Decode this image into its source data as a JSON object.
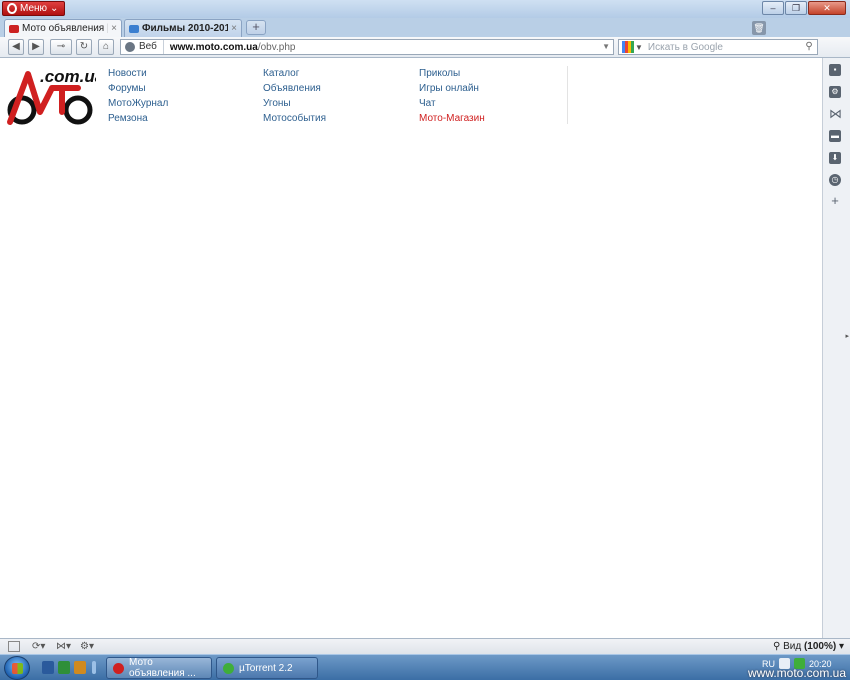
{
  "titlebar": {
    "menu_label": "Меню"
  },
  "tabs": [
    {
      "title": "Мото объявления | ...",
      "close": "×"
    },
    {
      "title": "Фильмы 2010-201...",
      "close": "×"
    }
  ],
  "new_tab_label": "+",
  "address": {
    "web_label": "Веб",
    "url_host": "www.moto.com.ua",
    "url_path": "/obv.php"
  },
  "search": {
    "placeholder": "Искать в Google"
  },
  "site": {
    "logo_text": ".com.ua",
    "nav_col1": [
      "Новости",
      "Форумы",
      "МотоЖурнал",
      "Ремзона"
    ],
    "nav_col2": [
      "Каталог",
      "Объявления",
      "Угоны",
      "Мотособытия"
    ],
    "nav_col3": [
      "Приколы",
      "Игры онлайн",
      "Чат",
      "Мото-Магазин"
    ],
    "highlight_color": "#d02020",
    "link_color": "#2d5f8f"
  },
  "statusbar": {
    "zoom_label": "Вид",
    "zoom_value": "(100%)"
  },
  "taskbar": {
    "tasks": [
      {
        "label": "Мото объявления ..."
      },
      {
        "label": "µTorrent 2.2"
      }
    ],
    "tray_lang": "RU",
    "clock": "20:20"
  },
  "watermark": "www.moto.com.ua"
}
